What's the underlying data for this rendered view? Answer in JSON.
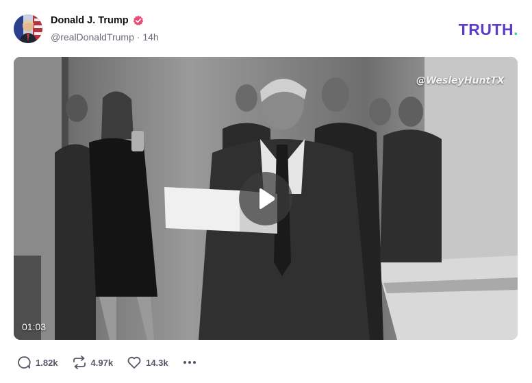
{
  "author": {
    "display_name": "Donald J. Trump",
    "handle": "@realDonaldTrump",
    "separator": "·",
    "time": "14h",
    "avatar_icon": "avatar-flag-portrait",
    "verified_color": "#ea4c78"
  },
  "brand": {
    "logo_text": "TRUTH",
    "logo_dot": ".",
    "primary_color": "#5a3ec8",
    "accent_color": "#2fd3b8"
  },
  "media": {
    "watermark": "@WesleyHuntTX",
    "duration": "01:03",
    "play_icon": "play-icon"
  },
  "actions": {
    "replies": "1.82k",
    "retruths": "4.97k",
    "likes": "14.3k",
    "more_icon": "more-icon"
  }
}
